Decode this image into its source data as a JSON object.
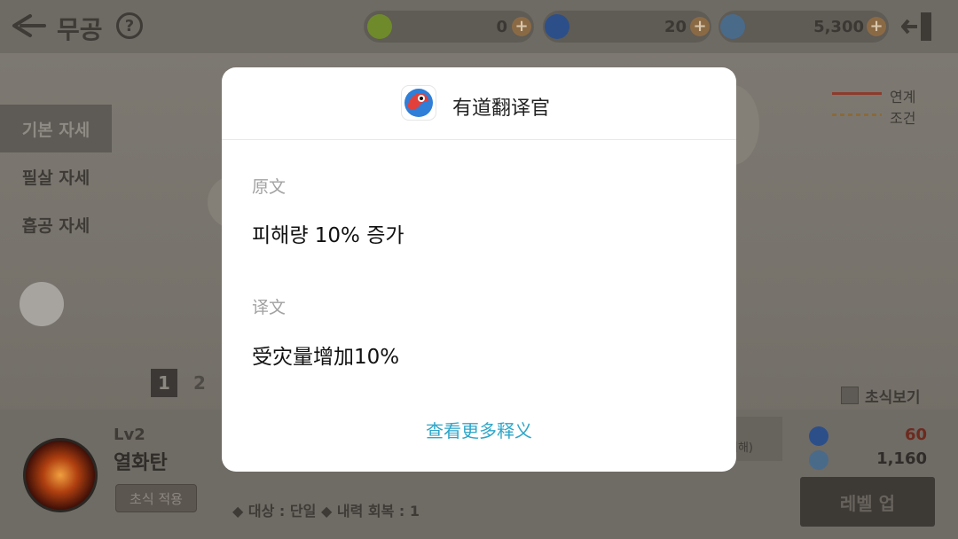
{
  "game": {
    "title": "무공",
    "help_icon_text": "?",
    "currencies": [
      {
        "name": "currency-1",
        "value": "0",
        "color": "#6f8a2a"
      },
      {
        "name": "currency-2",
        "value": "20",
        "color": "#2c4f8a"
      },
      {
        "name": "currency-3",
        "value": "5,300",
        "color": "#4a6a8a"
      }
    ],
    "plus_label": "+",
    "tabs": [
      "기본 자세",
      "필살 자세",
      "흡공 자세"
    ],
    "legend": {
      "link_label": "연계",
      "condition_label": "조건",
      "link_color": "#8c3b2c",
      "condition_color": "#8a6a3a"
    },
    "pages": [
      "1",
      "2"
    ],
    "preview_label": "초식보기",
    "skill": {
      "level": "Lv2",
      "name": "열화탄",
      "apply_label": "초식 적용",
      "target_info": "대상 : 단일",
      "recovery_info": "내력 회복 : 1",
      "desc_tail": "피해)",
      "cost_primary": "60",
      "cost_secondary": "1,160"
    },
    "levelup_label": "레벨 업"
  },
  "dialog": {
    "app_name": "有道翻译官",
    "original_label": "原文",
    "original_text": "피해량 10% 증가",
    "translation_label": "译文",
    "translation_text": "受灾量增加10%",
    "more_link": "查看更多释义"
  }
}
